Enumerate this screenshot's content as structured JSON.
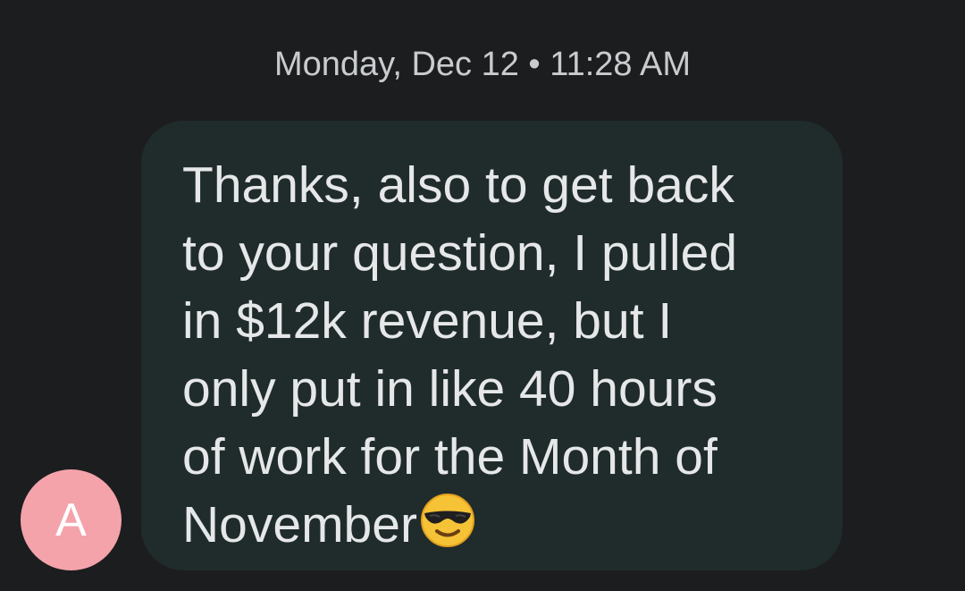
{
  "conversation": {
    "timestamp": "Monday, Dec 12 • 11:28 AM",
    "message": {
      "sender_initial": "A",
      "lines": [
        "Thanks, also to get back",
        "to your question, I pulled",
        "in $12k revenue, but I",
        "only put in like 40 hours",
        "of work for the Month of",
        "November"
      ],
      "emoji": "smiling-face-with-sunglasses",
      "colors": {
        "background": "#1c1d1f",
        "bubble": "#202c2b",
        "text": "#e5e7e8",
        "timestamp": "#c9cccf",
        "avatar": "#f4a3ab"
      }
    }
  }
}
